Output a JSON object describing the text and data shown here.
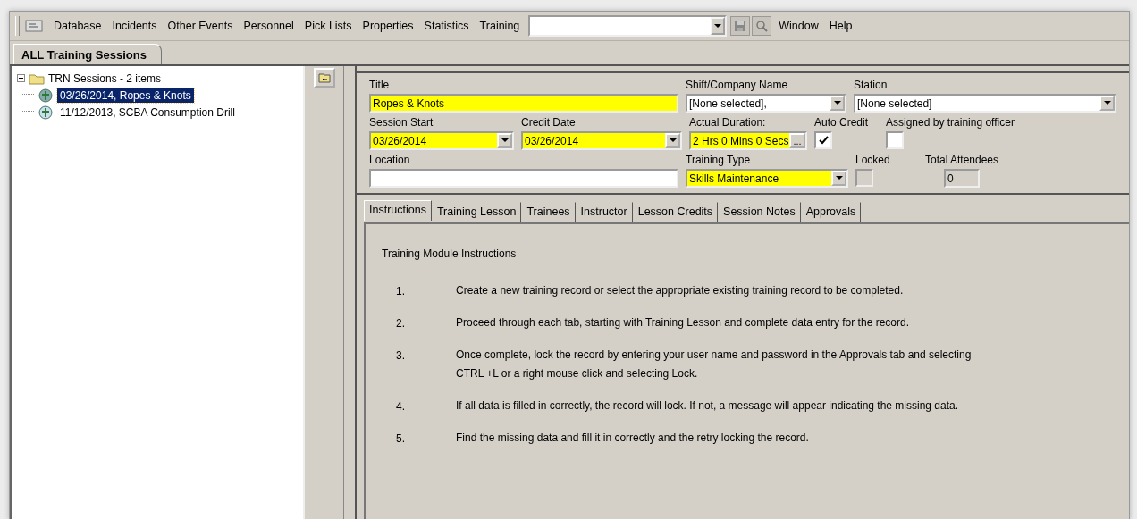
{
  "menu": {
    "items": [
      "Database",
      "Incidents",
      "Other Events",
      "Personnel",
      "Pick Lists",
      "Properties",
      "Statistics",
      "Training"
    ],
    "trailing_items": [
      "Window",
      "Help"
    ]
  },
  "view_tab": {
    "label": "ALL Training Sessions"
  },
  "tree": {
    "label": "TRN Sessions - 2 items",
    "expanded": true,
    "children": [
      {
        "label": "03/26/2014, Ropes & Knots",
        "selected": true
      },
      {
        "label": "11/12/2013, SCBA Consumption Drill",
        "selected": false
      }
    ]
  },
  "form": {
    "fields": [
      {
        "kind": "text",
        "label": "Title",
        "value": "Ropes & Knots",
        "required": true
      },
      {
        "kind": "dropdown",
        "label": "Shift/Company Name",
        "value": "[None selected],",
        "required": false
      },
      {
        "kind": "dropdown",
        "label": "Station",
        "value": "[None selected]",
        "required": false
      },
      {
        "kind": "dropdown",
        "label": "Session Start",
        "value": "03/26/2014",
        "required": true
      },
      {
        "kind": "dropdown",
        "label": "Credit Date",
        "value": "03/26/2014",
        "required": true
      },
      {
        "kind": "browse",
        "label": "Actual Duration:",
        "value": "2 Hrs 0 Mins 0 Secs",
        "required": true,
        "button": "..."
      },
      {
        "kind": "checkbox",
        "label": "Auto Credit",
        "checked": true,
        "disabled": false
      },
      {
        "kind": "checkbox",
        "label": "Assigned by training officer",
        "checked": false,
        "disabled": false
      },
      {
        "kind": "text",
        "label": "Location",
        "required": false
      },
      {
        "kind": "dropdown",
        "label": "Training Type",
        "value": "Skills Maintenance",
        "required": true
      },
      {
        "kind": "checkbox",
        "label": "Locked",
        "checked": false,
        "disabled": true
      },
      {
        "kind": "readonly",
        "label": "Total Attendees",
        "value": "0"
      }
    ]
  },
  "tabs": [
    {
      "label": "Instructions",
      "selected": true
    },
    {
      "label": "Training Lesson",
      "selected": false
    },
    {
      "label": "Trainees",
      "selected": false
    },
    {
      "label": "Instructor",
      "selected": false
    },
    {
      "label": "Lesson Credits",
      "selected": false
    },
    {
      "label": "Session Notes",
      "selected": false
    },
    {
      "label": "Approvals",
      "selected": false
    }
  ],
  "instructions": {
    "heading": "Training Module Instructions",
    "steps": [
      {
        "number": "1.",
        "lines": [
          "Create a new training record or select the appropriate existing training record to be completed."
        ]
      },
      {
        "number": "2.",
        "lines": [
          "Proceed through each tab, starting with Training Lesson and complete data entry for the record."
        ]
      },
      {
        "number": "3.",
        "lines": [
          "Once complete, lock the record by entering your user name and password in the Approvals tab and selecting",
          "CTRL +L or a right mouse click and selecting Lock."
        ]
      },
      {
        "number": "4.",
        "lines": [
          "If all data is filled in correctly, the record will lock.  If not, a message will appear indicating the missing data."
        ]
      },
      {
        "number": "5.",
        "lines": [
          "Find the missing data and fill it in correctly and the retry locking the record."
        ]
      }
    ]
  }
}
